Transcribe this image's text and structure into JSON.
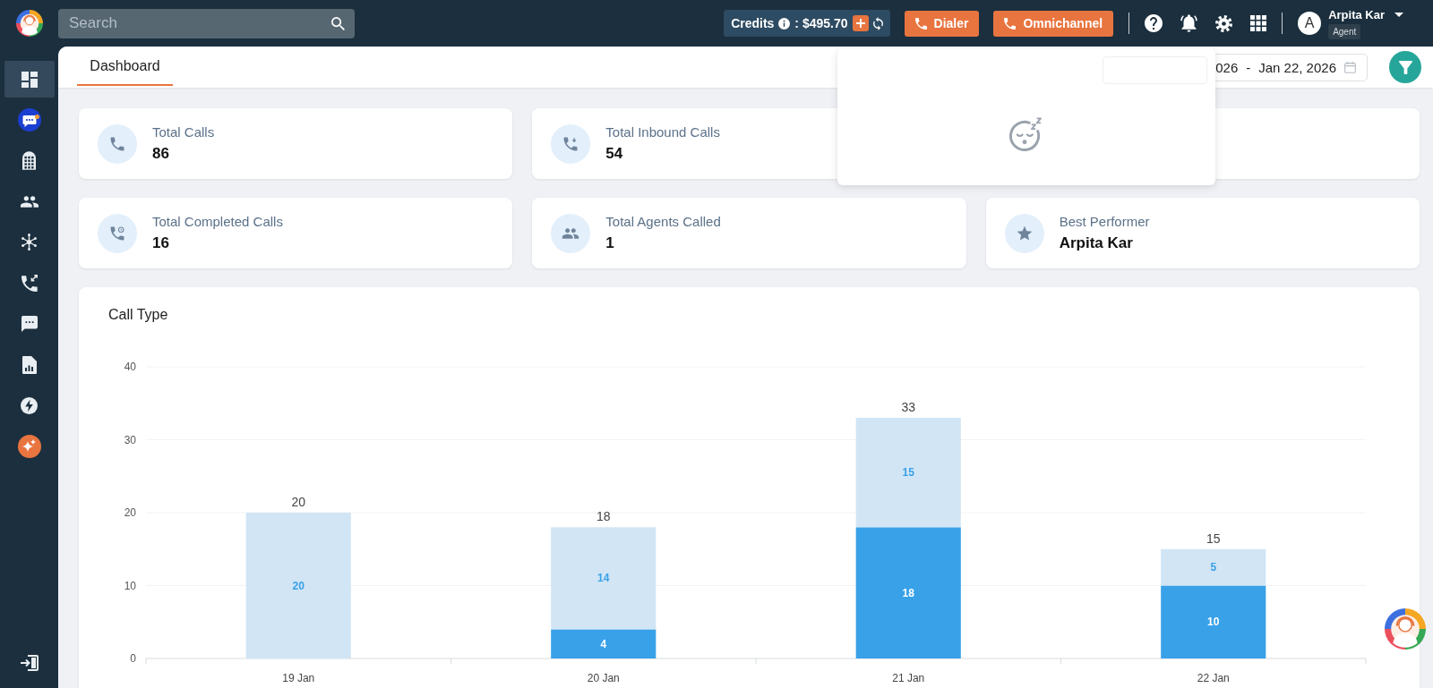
{
  "topbar": {
    "search": {
      "placeholder": "Search"
    },
    "credits": {
      "label": "Credits",
      "amount": ": $495.70"
    },
    "buttons": [
      {
        "label": "Dialer"
      },
      {
        "label": "Omnichannel"
      }
    ],
    "user": {
      "initial": "A",
      "name": "Arpita Kar",
      "role": "Agent"
    }
  },
  "sidebar": {
    "items": [
      {
        "selected": true,
        "notification": false
      },
      {
        "selected": false,
        "notification": true
      },
      {
        "selected": false,
        "notification": false
      },
      {
        "selected": false,
        "notification": false
      },
      {
        "selected": false,
        "notification": false
      },
      {
        "selected": false,
        "notification": false
      },
      {
        "selected": false,
        "notification": false
      },
      {
        "selected": false,
        "notification": false
      },
      {
        "selected": false,
        "notification": false
      },
      {
        "selected": false,
        "notification": false
      }
    ]
  },
  "header": {
    "tabs": [
      {
        "label": "Dashboard",
        "selected": true
      }
    ],
    "date_range": {
      "start": "026",
      "separator": "-",
      "end": "Jan 22, 2026"
    }
  },
  "popup": {
    "open": true
  },
  "stats": [
    {
      "kind": "stat",
      "label": "Total Calls",
      "value": "86"
    },
    {
      "kind": "stat",
      "label": "Total Inbound Calls",
      "value": "54"
    },
    {
      "kind": "blank"
    },
    {
      "kind": "stat",
      "label": "Total Completed Calls",
      "value": "16"
    },
    {
      "kind": "stat",
      "label": "Total Agents Called",
      "value": "1"
    },
    {
      "kind": "stat",
      "label": "Best Performer",
      "value": "Arpita Kar"
    }
  ],
  "chart": {
    "title": "Call Type",
    "chart_data": {
      "type": "bar",
      "categories": [
        "19 Jan",
        "20 Jan",
        "21 Jan",
        "22 Jan"
      ],
      "series": [
        {
          "color": "#38a1e8",
          "values": [
            null,
            4,
            18,
            10
          ],
          "value_labels": [
            null,
            "4",
            "18",
            "10"
          ]
        },
        {
          "color": "#d1e5f5",
          "values": [
            20,
            14,
            15,
            5
          ],
          "value_labels": [
            "20",
            "14",
            "15",
            "5"
          ]
        }
      ],
      "stacked": true,
      "grid": true,
      "ylim": [
        0,
        40
      ],
      "yticks": [
        0,
        10,
        20,
        30,
        40
      ],
      "annotations": [
        "20",
        "18",
        "33",
        "15"
      ]
    }
  }
}
